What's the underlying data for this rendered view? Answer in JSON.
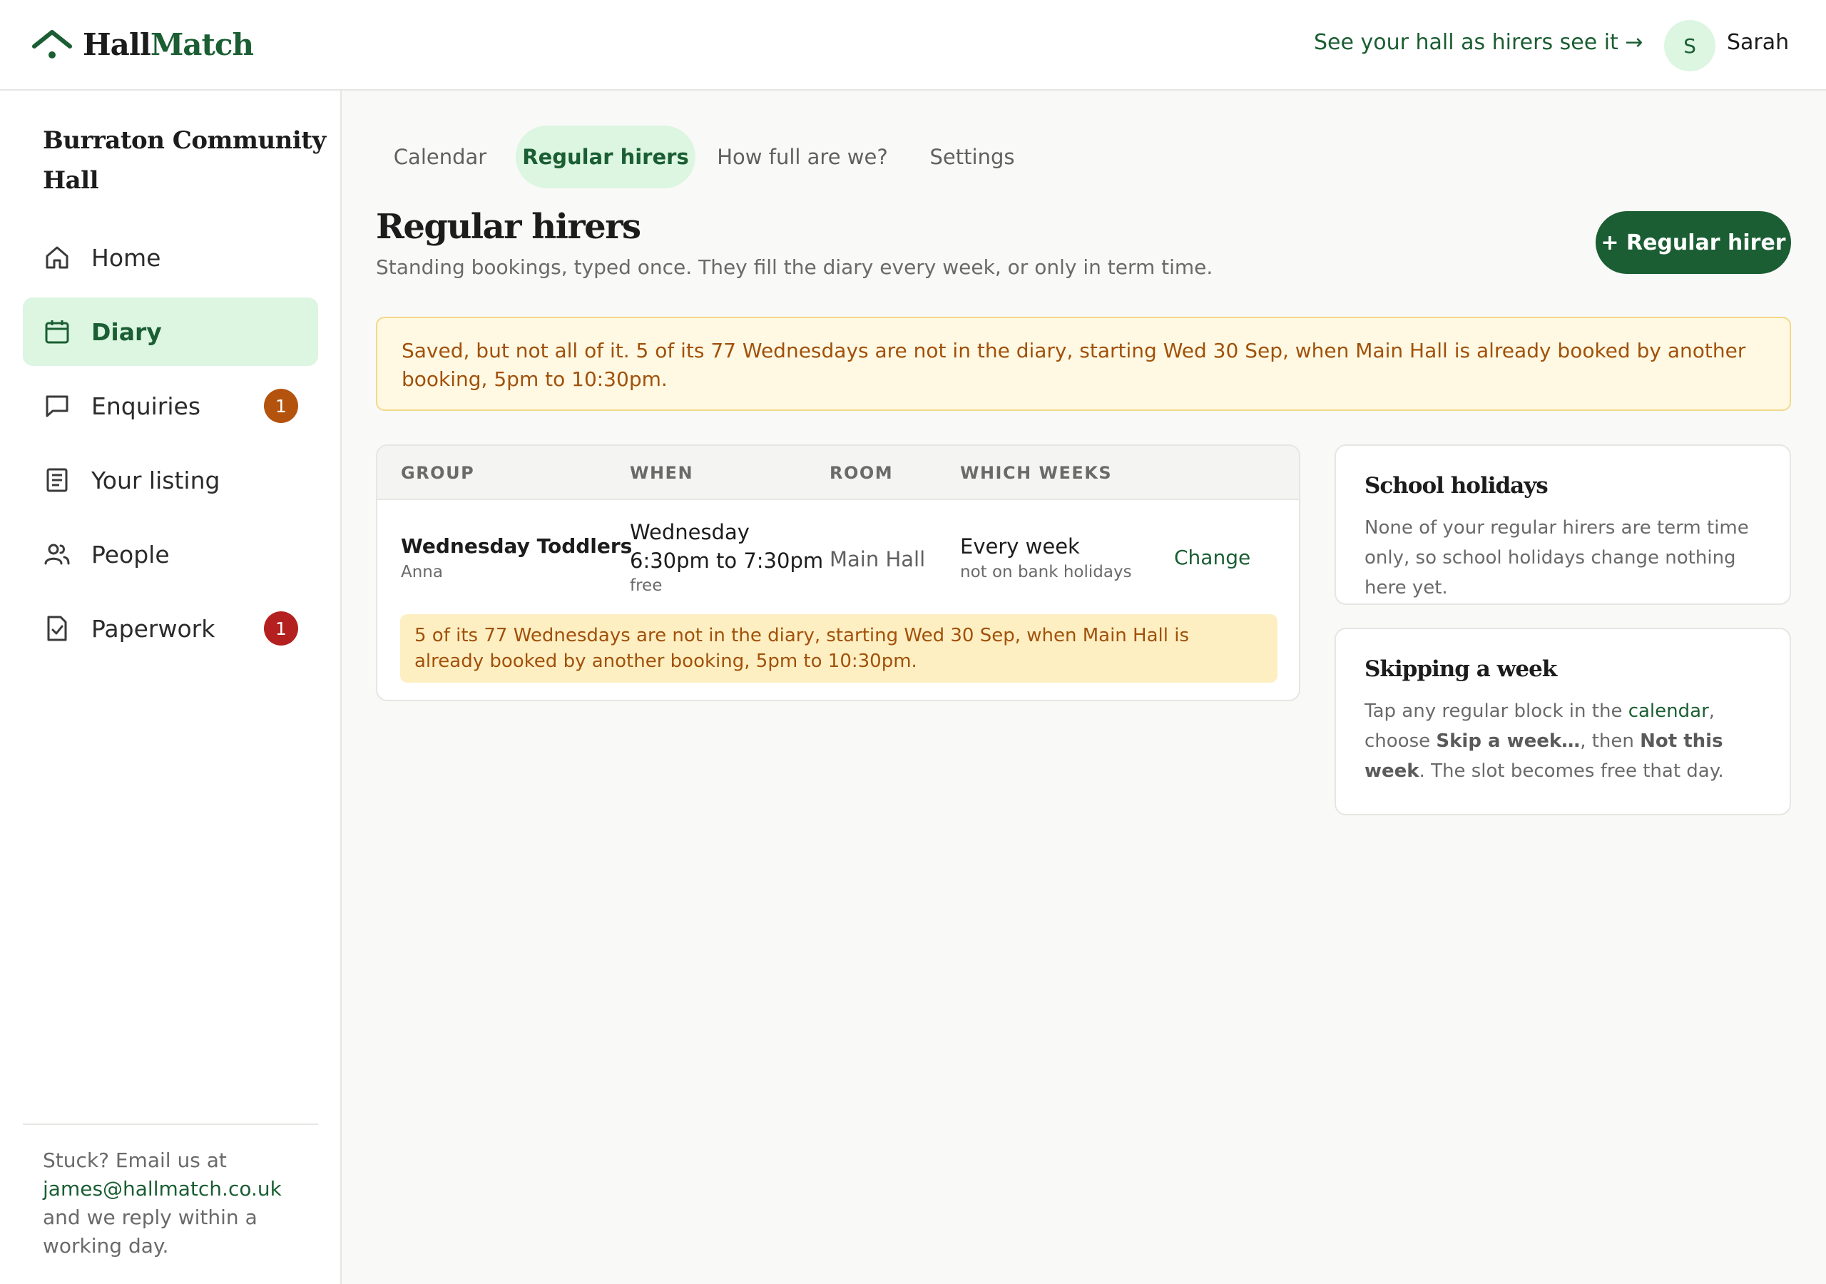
{
  "header": {
    "logo_part1": "Hall",
    "logo_part2": "Match",
    "preview_link": "See your hall as hirers see it →",
    "avatar_initial": "S",
    "user_name": "Sarah"
  },
  "sidebar": {
    "hall_name": "Burraton Community Hall",
    "items": [
      {
        "label": "Home",
        "icon": "home-icon"
      },
      {
        "label": "Diary",
        "icon": "calendar-icon",
        "active": true
      },
      {
        "label": "Enquiries",
        "icon": "chat-icon",
        "badge": "1"
      },
      {
        "label": "Your listing",
        "icon": "listing-icon"
      },
      {
        "label": "People",
        "icon": "people-icon"
      },
      {
        "label": "Paperwork",
        "icon": "paperwork-icon",
        "badge": "1"
      }
    ],
    "help_prefix": "Stuck? Email us at",
    "help_email": "james@hallmatch.co.uk",
    "help_suffix": "and we reply within a working day."
  },
  "tabs": [
    "Calendar",
    "Regular hirers",
    "How full are we?",
    "Settings"
  ],
  "page": {
    "title": "Regular hirers",
    "subtitle": "Standing bookings, typed once. They fill the diary every week, or only in term time.",
    "add_button": "+ Regular hirer",
    "alert": "Saved, but not all of it. 5 of its 77 Wednesdays are not in the diary, starting Wed 30 Sep, when Main Hall is already booked by another booking, 5pm to 10:30pm."
  },
  "table": {
    "headers": [
      "GROUP",
      "WHEN",
      "ROOM",
      "WHICH WEEKS"
    ],
    "rows": [
      {
        "group": "Wednesday Toddlers",
        "contact": "Anna",
        "day": "Wednesday",
        "time": "6:30pm to 7:30pm",
        "price": "free",
        "room": "Main Hall",
        "weeks": "Every week",
        "weeks_note": "not on bank holidays",
        "action": "Change",
        "warning": "5 of its 77 Wednesdays are not in the diary, starting Wed 30 Sep, when Main Hall is already booked by another booking, 5pm to 10:30pm."
      }
    ]
  },
  "cards": {
    "holidays_title": "School holidays",
    "holidays_body": "None of your regular hirers are term time only, so school holidays change nothing here yet.",
    "skip_title": "Skipping a week",
    "skip_body_1": "Tap any regular block in the ",
    "skip_link": "calendar",
    "skip_body_2": ", choose ",
    "skip_bold_1": "Skip a week…",
    "skip_body_3": ", then ",
    "skip_bold_2": "Not this week",
    "skip_body_4": ". The slot becomes free that day."
  },
  "colors": {
    "brand": "#1b5e33",
    "brand_light": "#dcf6e1",
    "warning_text": "#a1510b",
    "badge_orange": "#b3530e",
    "badge_red": "#b42020"
  }
}
